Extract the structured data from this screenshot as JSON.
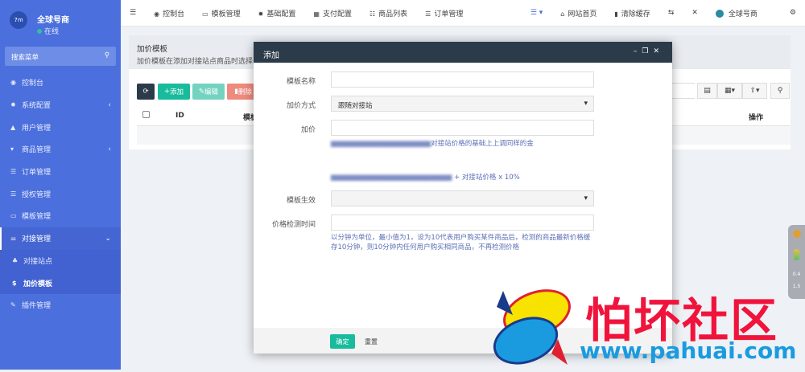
{
  "sidebar": {
    "user": "全球号商",
    "status": "在线",
    "search_placeholder": "搜索菜单",
    "items": [
      {
        "label": "控制台",
        "icon": "dashboard-icon"
      },
      {
        "label": "系统配置",
        "icon": "gear-icon"
      },
      {
        "label": "用户管理",
        "icon": "user-icon"
      },
      {
        "label": "商品管理",
        "icon": "cart-icon"
      },
      {
        "label": "订单管理",
        "icon": "list-icon"
      },
      {
        "label": "授权管理",
        "icon": "list-icon"
      },
      {
        "label": "模板管理",
        "icon": "template-icon"
      },
      {
        "label": "对接管理",
        "icon": "sliders-icon"
      },
      {
        "label": "对接站点",
        "icon": "sitemap-icon"
      },
      {
        "label": "加价模板",
        "icon": "dollar-icon"
      },
      {
        "label": "插件管理",
        "icon": "plug-icon"
      }
    ]
  },
  "topbar": {
    "items": [
      "控制台",
      "模板管理",
      "基础配置",
      "支付配置",
      "商品列表",
      "订单管理"
    ],
    "right": [
      "网站首页",
      "清除缓存"
    ],
    "user": "全球号商"
  },
  "page": {
    "title": "加价模板",
    "desc": "加价模板在添加对接站点商品时选择,",
    "buttons": {
      "add": "添加",
      "edit": "编辑",
      "delete": "删除"
    },
    "columns": {
      "id": "ID",
      "name": "模板",
      "ops": "操作"
    }
  },
  "modal": {
    "title": "添加",
    "fields": {
      "name_label": "模板名称",
      "mode_label": "加价方式",
      "mode_value": "跟随对接站",
      "price_label": "加价",
      "price_help": "对接站价格的基础上上调同样的金",
      "formula_help": "+ 对接站价格 x 10%",
      "effect_label": "模板生效",
      "check_label": "价格检测时间",
      "check_help": "以分钟为单位，最小值为1，设为10代表用户购买某件商品后，检测的商品最新价格缓存10分钟，则10分钟内任何用户购买相同商品，不再检测价格"
    },
    "ok": "确定",
    "reset": "重置"
  },
  "float_widget": {
    "v1": "0.4",
    "v2": "1.5"
  },
  "watermark": {
    "text": "怕坏社区",
    "url": "www.pahuai.com"
  },
  "colors": {
    "sidebar": "#4b6fdc",
    "modal_header": "#2c3b4a",
    "primary": "#18bc9c",
    "danger": "#e74c3c"
  }
}
